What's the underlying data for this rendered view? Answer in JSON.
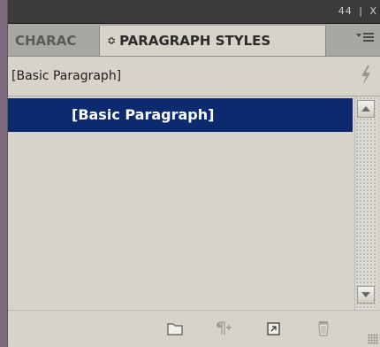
{
  "panel": {
    "window_controls": [
      "44",
      "|",
      "X"
    ],
    "tabs": [
      {
        "label": "CHARAC",
        "active": false
      },
      {
        "label": "PARAGRAPH STYLES",
        "active": true
      }
    ],
    "tab_active_prefix": "≎",
    "menu_icon": "panel-menu-icon",
    "current_style_label": "[Basic Paragraph]",
    "styles": [
      {
        "name": "[Basic Paragraph]",
        "selected": true
      }
    ],
    "footer_icons": [
      "style-group-folder-icon",
      "clear-overrides-icon",
      "new-style-icon",
      "delete-style-icon"
    ],
    "colors": {
      "selection": "#0d2a6e",
      "panel_bg": "#d7d3cb",
      "titlebar": "#3b3b3b"
    }
  }
}
